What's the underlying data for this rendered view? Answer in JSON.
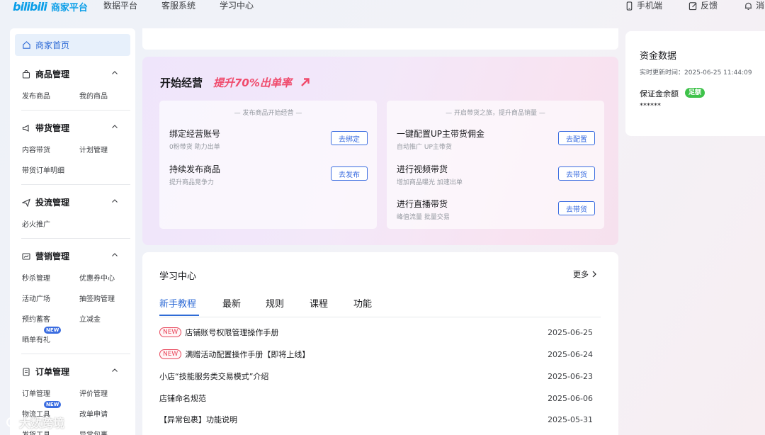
{
  "topbar": {
    "logo_mark": "bilibili",
    "logo_text": "商家平台",
    "nav": [
      "数据平台",
      "客服系统",
      "学习中心"
    ],
    "mobile": "手机端",
    "feedback": "反馈",
    "message": "消"
  },
  "sidebar": {
    "home": "商家首页",
    "groups": [
      {
        "title": "商品管理",
        "items": [
          "发布商品",
          "我的商品"
        ]
      },
      {
        "title": "带货管理",
        "items": [
          "内容带货",
          "计划管理",
          "带货订单明细"
        ]
      },
      {
        "title": "投流管理",
        "items": [
          "必火推广"
        ]
      },
      {
        "title": "营销管理",
        "items": [
          "秒杀管理",
          "优惠券中心",
          "活动广场",
          "抽签购管理",
          "预约蓄客",
          "立减金",
          "晒单有礼"
        ]
      },
      {
        "title": "订单管理",
        "items": [
          "订单管理",
          "评价管理",
          "物流工具",
          "改单申请",
          "发货工具",
          "异常包裹"
        ]
      }
    ],
    "new_badge": "NEW"
  },
  "start": {
    "title": "开始经营",
    "subtitle": "提升70%出单率",
    "left_panel": {
      "heading": "— 发布商品开始经营 —",
      "tasks": [
        {
          "name": "绑定经营账号",
          "desc": "0粉带货 助力出单",
          "button": "去绑定"
        },
        {
          "name": "持续发布商品",
          "desc": "提升商品竞争力",
          "button": "去发布"
        }
      ]
    },
    "right_panel": {
      "heading": "— 开启带货之旅，提升商品销量 —",
      "tasks": [
        {
          "name": "一键配置UP主带货佣金",
          "desc": "自动推广 UP主带货",
          "button": "去配置"
        },
        {
          "name": "进行视频带货",
          "desc": "增加商品曝光 加速出单",
          "button": "去带货"
        },
        {
          "name": "进行直播带货",
          "desc": "峰值流量 批量交易",
          "button": "去带货"
        }
      ]
    }
  },
  "learn": {
    "title": "学习中心",
    "more": "更多",
    "tabs": [
      "新手教程",
      "最新",
      "规则",
      "课程",
      "功能"
    ],
    "new_tag": "NEW",
    "articles": [
      {
        "title": "店铺账号权限管理操作手册",
        "date": "2025-06-25",
        "is_new": true
      },
      {
        "title": "满赠活动配置操作手册【即将上线】",
        "date": "2025-06-24",
        "is_new": true
      },
      {
        "title": "小店“技能服务类交易模式”介绍",
        "date": "2025-06-23",
        "is_new": false
      },
      {
        "title": "店铺命名规范",
        "date": "2025-06-06",
        "is_new": false
      },
      {
        "title": "【异常包裹】功能说明",
        "date": "2025-05-31",
        "is_new": false
      }
    ]
  },
  "fund": {
    "title": "资金数据",
    "update_time": "实时更新时间：2025-06-25 11:44:09",
    "label": "保证金余额",
    "tag": "足额",
    "value": "******"
  },
  "watermark": "大数跨境",
  "colors": {
    "brand": "#0a9ee8",
    "accent": "#2f6bd6",
    "highlight": "#f04b6c",
    "success": "#3ec24a"
  }
}
